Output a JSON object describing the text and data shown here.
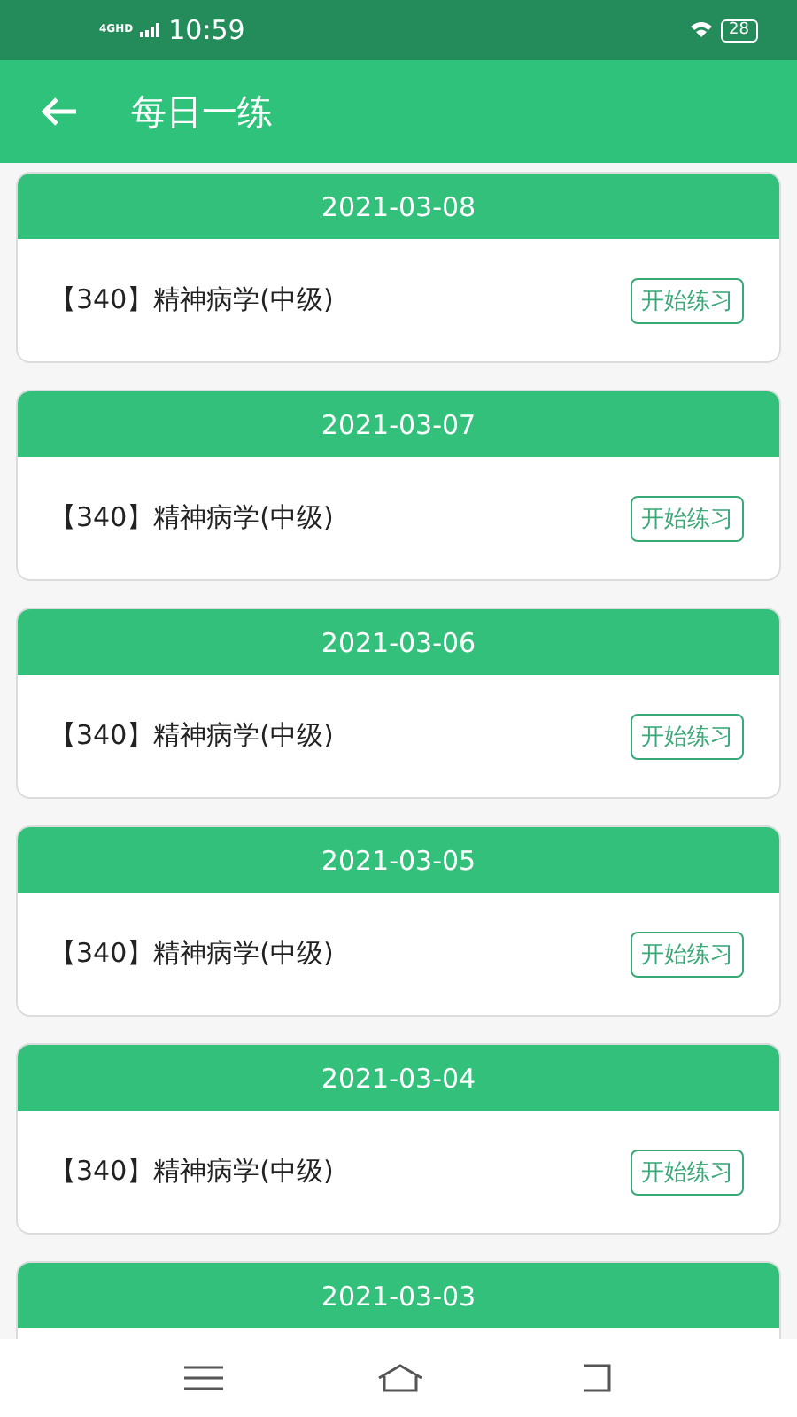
{
  "status_bar": {
    "network": "4GHD",
    "time": "10:59",
    "battery": "28"
  },
  "app_bar": {
    "title": "每日一练"
  },
  "items": [
    {
      "date": "2021-03-08",
      "title": "【340】精神病学(中级)",
      "button": "开始练习"
    },
    {
      "date": "2021-03-07",
      "title": "【340】精神病学(中级)",
      "button": "开始练习"
    },
    {
      "date": "2021-03-06",
      "title": "【340】精神病学(中级)",
      "button": "开始练习"
    },
    {
      "date": "2021-03-05",
      "title": "【340】精神病学(中级)",
      "button": "开始练习"
    },
    {
      "date": "2021-03-04",
      "title": "【340】精神病学(中级)",
      "button": "开始练习"
    },
    {
      "date": "2021-03-03"
    }
  ]
}
